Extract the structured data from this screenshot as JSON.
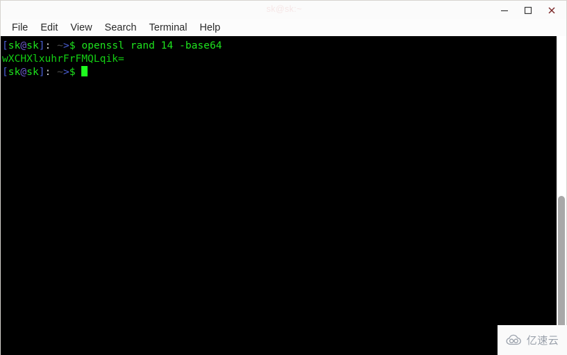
{
  "window": {
    "title": "sk@sk:~",
    "controls": {
      "minimize_label": "Minimize",
      "maximize_label": "Maximize",
      "close_label": "Close"
    }
  },
  "menubar": {
    "items": [
      {
        "label": "File"
      },
      {
        "label": "Edit"
      },
      {
        "label": "View"
      },
      {
        "label": "Search"
      },
      {
        "label": "Terminal"
      },
      {
        "label": "Help"
      }
    ]
  },
  "terminal": {
    "prompt": {
      "bracket_open": "[",
      "user_host": "sk@sk",
      "at": "@",
      "bracket_close": "]",
      "colon": ":",
      "tilde": "~",
      "arrow": ">",
      "dollar": "$"
    },
    "lines": [
      {
        "type": "prompt-command",
        "prompt_open": "[",
        "prompt_user": "sk",
        "prompt_at": "@",
        "prompt_host": "sk",
        "prompt_close": "]",
        "prompt_colon": ":",
        "prompt_tilde": "~",
        "prompt_arrow": ">",
        "prompt_dollar": "$",
        "command": "openssl rand 14 -base64"
      },
      {
        "type": "output",
        "text": "wXCHXlxuhrFrFMQLqik="
      },
      {
        "type": "prompt-cursor",
        "prompt_open": "[",
        "prompt_user": "sk",
        "prompt_at": "@",
        "prompt_host": "sk",
        "prompt_close": "]",
        "prompt_colon": ":",
        "prompt_tilde": "~",
        "prompt_arrow": ">",
        "prompt_dollar": "$",
        "command": ""
      }
    ],
    "colors": {
      "background": "#000000",
      "bracket": "#4a5fd4",
      "user_host": "#1ee31e",
      "at_sign": "#6a59c9",
      "colon": "#d8d8d8",
      "tilde": "#4d4d4d",
      "arrow": "#4a5fd4",
      "dollar": "#1ee31e",
      "command": "#1ee31e",
      "output": "#13cf13",
      "cursor": "#1efb1e"
    }
  },
  "scrollbar": {
    "name": "vertical-scrollbar"
  },
  "watermark": {
    "text": "亿速云",
    "icon": "cloud-icon",
    "color": "#9aa1ab"
  }
}
